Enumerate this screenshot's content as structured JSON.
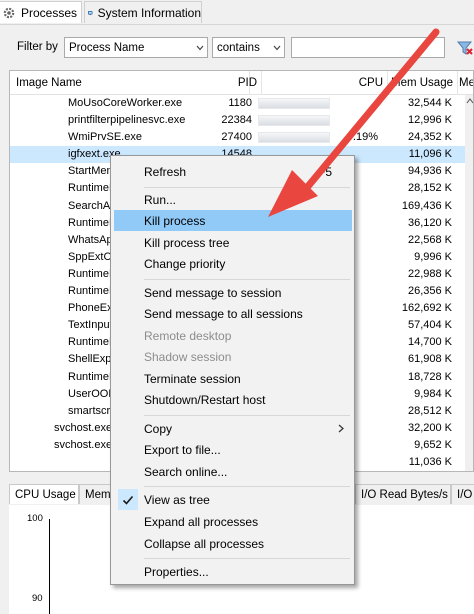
{
  "tabs": [
    {
      "label": "Processes",
      "icon": "gear-icon"
    },
    {
      "label": "System Information",
      "icon": "system-info-icon"
    }
  ],
  "filter": {
    "label": "Filter by",
    "field_value": "Process Name",
    "operator_value": "contains",
    "input_value": ""
  },
  "columns": {
    "name": "Image Name",
    "pid": "PID",
    "cpu": "CPU",
    "mem": "Mem Usage",
    "more": "Me"
  },
  "rows": [
    {
      "name": "MoUsoCoreWorker.exe",
      "pid": "1180",
      "cpu": "",
      "mem": "32,544 K"
    },
    {
      "name": "printfilterpipelinesvc.exe",
      "pid": "22384",
      "cpu": "",
      "mem": "12,996 K"
    },
    {
      "name": "WmiPrvSE.exe",
      "pid": "27400",
      "cpu": "0.19%",
      "mem": "24,352 K"
    },
    {
      "name": "igfxext.exe",
      "pid": "14548",
      "cpu": "",
      "mem": "11,096 K"
    },
    {
      "name": "StartMenuExperienceHost.exe",
      "pid": "",
      "cpu": "",
      "mem": "94,936 K"
    },
    {
      "name": "RuntimeBroker.exe",
      "pid": "",
      "cpu": "",
      "mem": "28,152 K"
    },
    {
      "name": "SearchApp.exe",
      "pid": "",
      "cpu": "",
      "mem": "169,436 K"
    },
    {
      "name": "RuntimeBroker.exe",
      "pid": "",
      "cpu": "",
      "mem": "36,120 K"
    },
    {
      "name": "WhatsApp.exe",
      "pid": "",
      "cpu": "",
      "mem": "22,568 K"
    },
    {
      "name": "SppExtComObj.exe",
      "pid": "",
      "cpu": "",
      "mem": "9,996 K"
    },
    {
      "name": "RuntimeBroker.exe",
      "pid": "",
      "cpu": "",
      "mem": "22,988 K"
    },
    {
      "name": "RuntimeBroker.exe",
      "pid": "",
      "cpu": "",
      "mem": "26,356 K"
    },
    {
      "name": "PhoneExperienceHost.exe",
      "pid": "",
      "cpu": "",
      "mem": "162,692 K"
    },
    {
      "name": "TextInputHost.exe",
      "pid": "",
      "cpu": "",
      "mem": "57,404 K"
    },
    {
      "name": "RuntimeBroker.exe",
      "pid": "",
      "cpu": "",
      "mem": "14,700 K"
    },
    {
      "name": "ShellExperienceHost.exe",
      "pid": "",
      "cpu": "",
      "mem": "61,908 K"
    },
    {
      "name": "RuntimeBroker.exe",
      "pid": "",
      "cpu": "",
      "mem": "18,728 K"
    },
    {
      "name": "UserOOBEBroker.exe",
      "pid": "",
      "cpu": "",
      "mem": "9,984 K"
    },
    {
      "name": "smartscreen.exe",
      "pid": "",
      "cpu": "",
      "mem": "28,512 K"
    },
    {
      "name": "svchost.exe",
      "pid": "",
      "cpu": "",
      "mem": "32,200 K"
    },
    {
      "name": "svchost.exe",
      "pid": "",
      "cpu": "",
      "mem": "9,652 K"
    },
    {
      "name": "",
      "pid": "",
      "cpu": "",
      "mem": "11,036 K"
    }
  ],
  "bottom_tabs": [
    {
      "label": "CPU Usage"
    },
    {
      "label": "Memo"
    },
    {
      "label": "I/O Read Bytes/s"
    },
    {
      "label": "I/O"
    }
  ],
  "graph": {
    "y_top_label": "100",
    "y_next_label": "90"
  },
  "context_menu": {
    "items": [
      {
        "label": "Refresh",
        "shortcut": "F5"
      },
      {
        "label": "Run..."
      },
      {
        "label": "Kill process",
        "highlighted": true
      },
      {
        "label": "Kill process tree"
      },
      {
        "label": "Change priority"
      },
      {
        "label": "Send message to session"
      },
      {
        "label": "Send message to all sessions"
      },
      {
        "label": "Remote desktop",
        "disabled": true
      },
      {
        "label": "Shadow session",
        "disabled": true
      },
      {
        "label": "Terminate session"
      },
      {
        "label": "Shutdown/Restart host"
      },
      {
        "label": "Copy",
        "submenu": true
      },
      {
        "label": "Export to file..."
      },
      {
        "label": "Search online..."
      },
      {
        "label": "View as tree",
        "checked": true
      },
      {
        "label": "Expand all processes"
      },
      {
        "label": "Collapse all processes"
      },
      {
        "label": "Properties..."
      }
    ]
  },
  "colors": {
    "selected_row": "#cce8ff",
    "menu_highlight": "#91c9f7",
    "annotation_arrow": "#e8463f"
  }
}
